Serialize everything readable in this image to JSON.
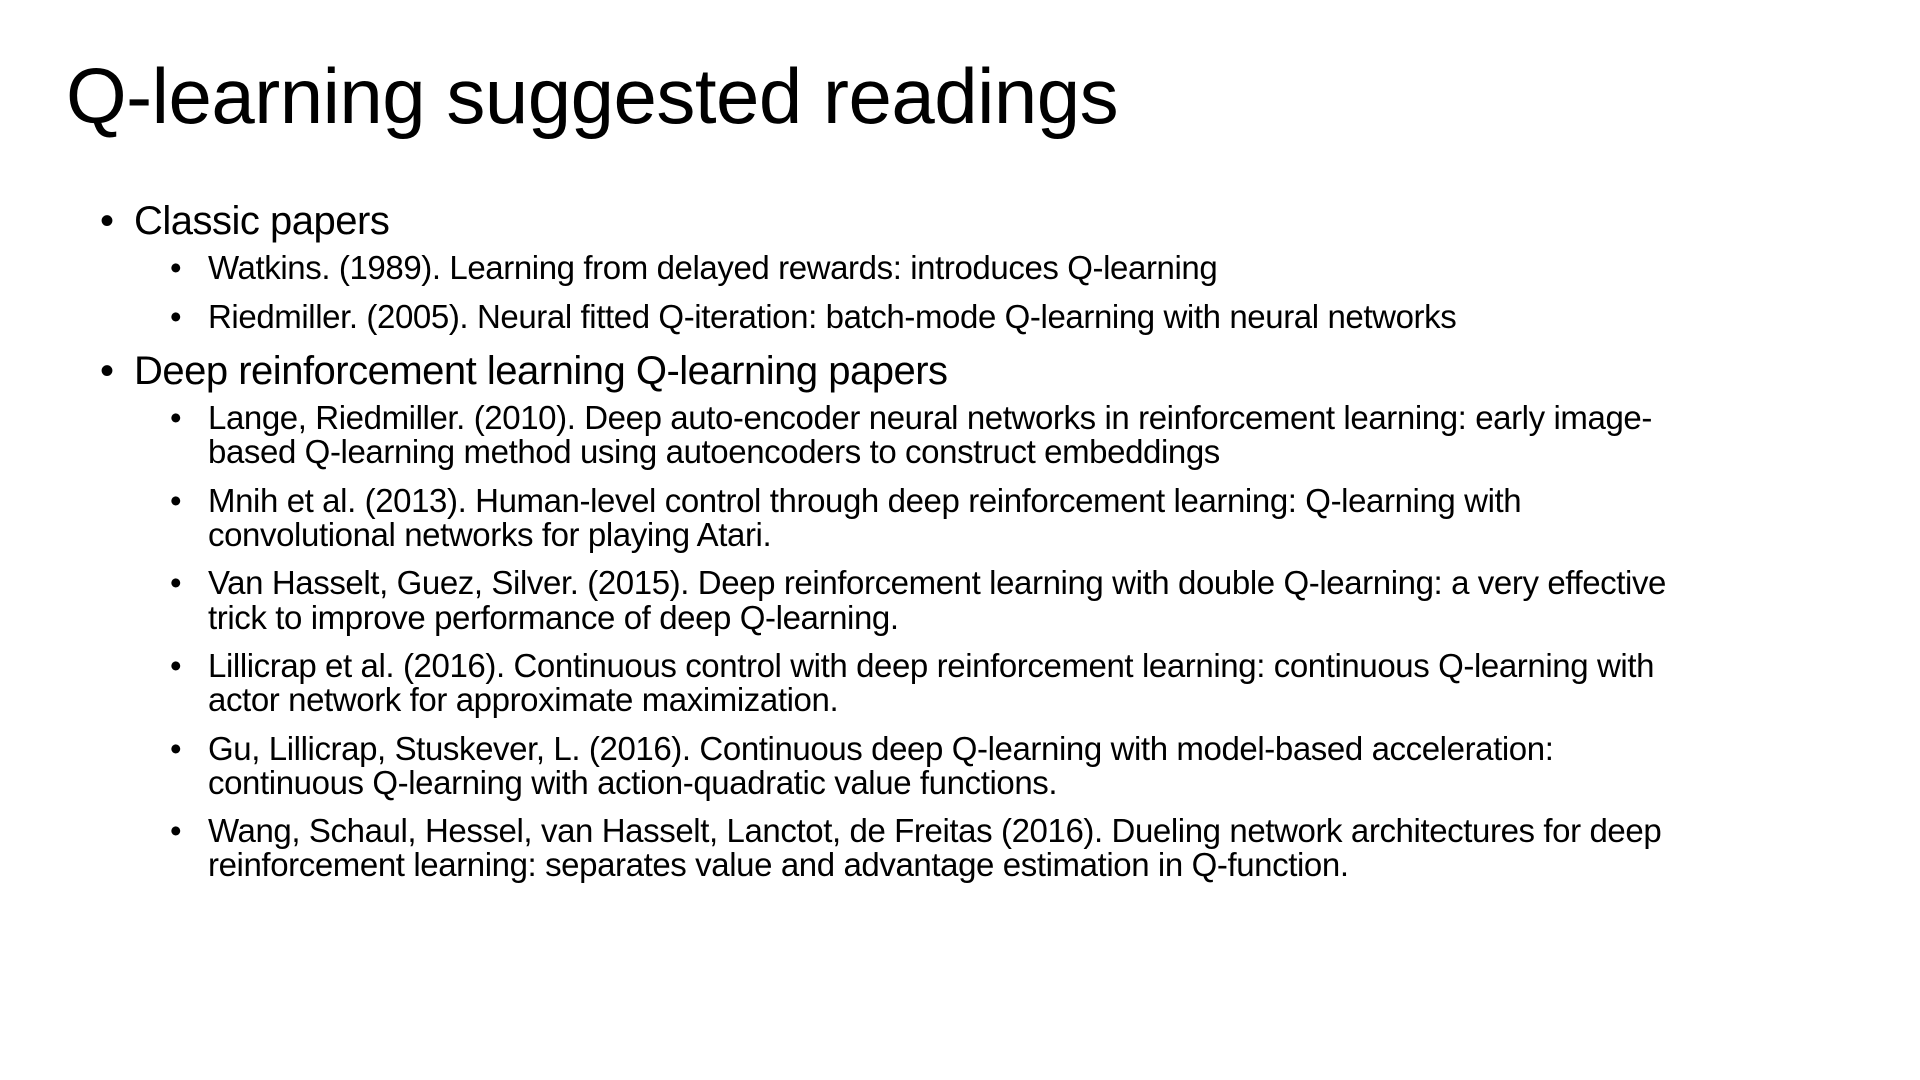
{
  "slide": {
    "title": "Q-learning suggested readings",
    "bullet_glyph": "•",
    "sections": [
      {
        "heading": "Classic papers",
        "items": [
          "Watkins. (1989). Learning from delayed rewards: introduces Q-learning",
          "Riedmiller. (2005). Neural fitted Q-iteration: batch-mode Q-learning with neural networks"
        ]
      },
      {
        "heading": "Deep reinforcement learning Q-learning papers",
        "items": [
          "Lange, Riedmiller. (2010). Deep auto-encoder neural networks in reinforcement learning: early image-based Q-learning method using autoencoders to construct embeddings",
          "Mnih et al. (2013). Human-level control through deep reinforcement learning: Q-learning with convolutional networks for playing Atari.",
          "Van Hasselt, Guez, Silver. (2015). Deep reinforcement learning with double Q-learning: a very effective trick to improve performance of deep Q-learning.",
          "Lillicrap et al. (2016). Continuous control with deep reinforcement learning: continuous Q-learning with actor network for approximate maximization.",
          "Gu, Lillicrap, Stuskever, L. (2016). Continuous deep Q-learning with model-based acceleration: continuous Q-learning with action-quadratic value functions.",
          "Wang, Schaul, Hessel, van Hasselt, Lanctot, de Freitas (2016). Dueling network architectures for deep reinforcement learning: separates value and advantage estimation in Q-function."
        ]
      }
    ]
  }
}
